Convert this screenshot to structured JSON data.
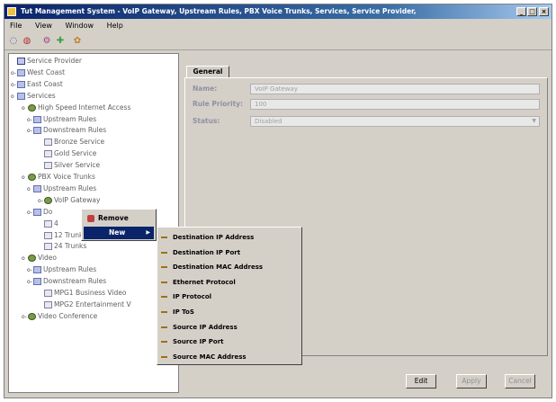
{
  "window": {
    "title": "Tut Management System - VoIP Gateway, Upstream Rules, PBX Voice Trunks, Services, Service Provider,",
    "controls": [
      "_",
      "□",
      "×"
    ]
  },
  "menu": [
    "File",
    "View",
    "Window",
    "Help"
  ],
  "toolbar_icons": [
    "open-icon",
    "record-icon",
    "gear-icon",
    "add-icon",
    "settings-icon"
  ],
  "tree": {
    "items": [
      {
        "label": "Service Provider",
        "icon": "sp",
        "exp": ""
      },
      {
        "label": "West Coast",
        "icon": "folder",
        "exp": "o-"
      },
      {
        "label": "East Coast",
        "icon": "folder",
        "exp": "o-"
      },
      {
        "label": "Services",
        "icon": "folder",
        "exp": "o"
      },
      {
        "label": "High Speed Internet Access",
        "icon": "gear",
        "exp": "o"
      },
      {
        "label": "Upstream Rules",
        "icon": "folder",
        "exp": "o-"
      },
      {
        "label": "Downstream Rules",
        "icon": "folder",
        "exp": "o-"
      },
      {
        "label": "Bronze Service",
        "icon": "doc",
        "exp": ""
      },
      {
        "label": "Gold Service",
        "icon": "doc",
        "exp": ""
      },
      {
        "label": "Silver Service",
        "icon": "doc",
        "exp": ""
      },
      {
        "label": "PBX Voice Trunks",
        "icon": "gear",
        "exp": "o"
      },
      {
        "label": "Upstream Rules",
        "icon": "folder",
        "exp": "o"
      },
      {
        "label": "VoIP Gateway",
        "icon": "gear",
        "exp": "o-"
      },
      {
        "label": "Do",
        "icon": "folder",
        "exp": "o-"
      },
      {
        "label": "4",
        "icon": "doc",
        "exp": ""
      },
      {
        "label": "12 Trunks",
        "icon": "doc",
        "exp": ""
      },
      {
        "label": "24 Trunks",
        "icon": "doc",
        "exp": ""
      },
      {
        "label": "Video",
        "icon": "gear",
        "exp": "o"
      },
      {
        "label": "Upstream Rules",
        "icon": "folder",
        "exp": "o-"
      },
      {
        "label": "Downstream Rules",
        "icon": "folder",
        "exp": "o-"
      },
      {
        "label": "MPG1 Business Video",
        "icon": "doc",
        "exp": ""
      },
      {
        "label": "MPG2 Entertainment V",
        "icon": "doc",
        "exp": ""
      },
      {
        "label": "Video Conference",
        "icon": "gear",
        "exp": "o-"
      }
    ]
  },
  "tabs": [
    "General"
  ],
  "form": {
    "name_label": "Name:",
    "name_value": "VoIP Gateway",
    "priority_label": "Rule Priority:",
    "priority_value": "100",
    "status_label": "Status:",
    "status_value": "Disabled"
  },
  "buttons": {
    "edit": "Edit",
    "apply": "Apply",
    "cancel": "Cancel"
  },
  "context_menu": {
    "remove": "Remove",
    "new": "New",
    "new_arrow": "▶"
  },
  "submenu": [
    "Destination IP Address",
    "Destination IP Port",
    "Destination MAC Address",
    "Ethernet Protocol",
    "IP Protocol",
    "IP ToS",
    "Source IP Address",
    "Source IP Port",
    "Source MAC Address"
  ]
}
